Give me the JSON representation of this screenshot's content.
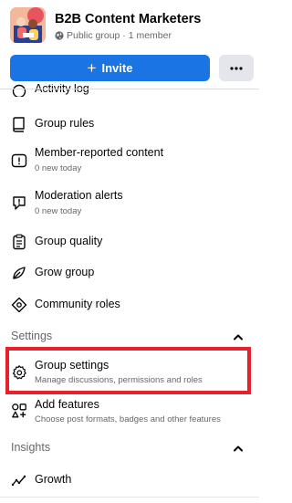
{
  "group": {
    "name": "B2B Content Marketers",
    "meta": "Public group · 1 member"
  },
  "actions": {
    "invite_label": "Invite"
  },
  "menu": {
    "activity_log": "Activity log",
    "group_rules": "Group rules",
    "member_reported": {
      "label": "Member-reported content",
      "sub": "0 new today"
    },
    "moderation_alerts": {
      "label": "Moderation alerts",
      "sub": "0 new today"
    },
    "group_quality": "Group quality",
    "grow_group": "Grow group",
    "community_roles": "Community roles"
  },
  "settings": {
    "title": "Settings",
    "group_settings": {
      "label": "Group settings",
      "sub": "Manage discussions, permissions and roles"
    },
    "add_features": {
      "label": "Add features",
      "sub": "Choose post formats, badges and other features"
    }
  },
  "insights": {
    "title": "Insights",
    "growth": "Growth"
  },
  "colors": {
    "accent": "#1b74e4",
    "highlight": "#e8202a",
    "secondary_text": "#65676b"
  }
}
